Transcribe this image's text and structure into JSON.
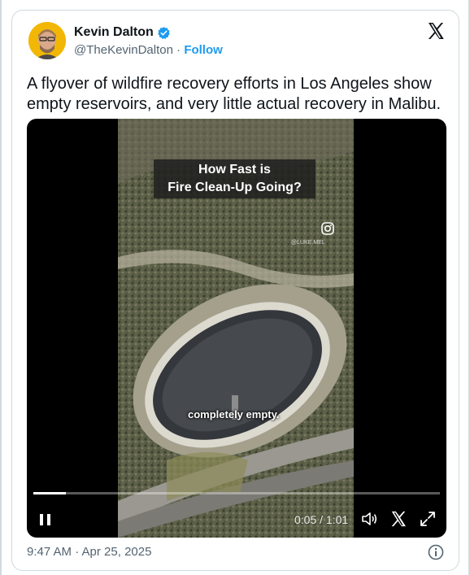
{
  "author": {
    "name": "Kevin Dalton",
    "handle": "@TheKevinDalton",
    "separator": "·",
    "follow_label": "Follow"
  },
  "tweet": {
    "text": "A flyover of wildfire recovery efforts in Los Angeles show empty reservoirs, and very little actual recovery in Malibu.",
    "timestamp": "9:47 AM · Apr 25, 2025"
  },
  "video": {
    "overlay_title_line1": "How Fast is",
    "overlay_title_line2": "Fire Clean-Up Going?",
    "caption": "completely empty.",
    "watermark": "@LUKE.MEL",
    "current_time": "0:05",
    "time_separator": "/",
    "duration": "1:01",
    "progress": 0.079
  },
  "icons": {
    "verified": "verified-badge-icon",
    "x_logo": "x-logo-icon",
    "pause": "pause-icon",
    "volume": "volume-icon",
    "x_share": "x-logo-icon",
    "fullscreen": "fullscreen-icon",
    "info": "info-icon",
    "instagram": "instagram-icon"
  },
  "colors": {
    "accent": "#1d9bf0",
    "secondary_text": "#536471",
    "primary_text": "#0f1419"
  }
}
